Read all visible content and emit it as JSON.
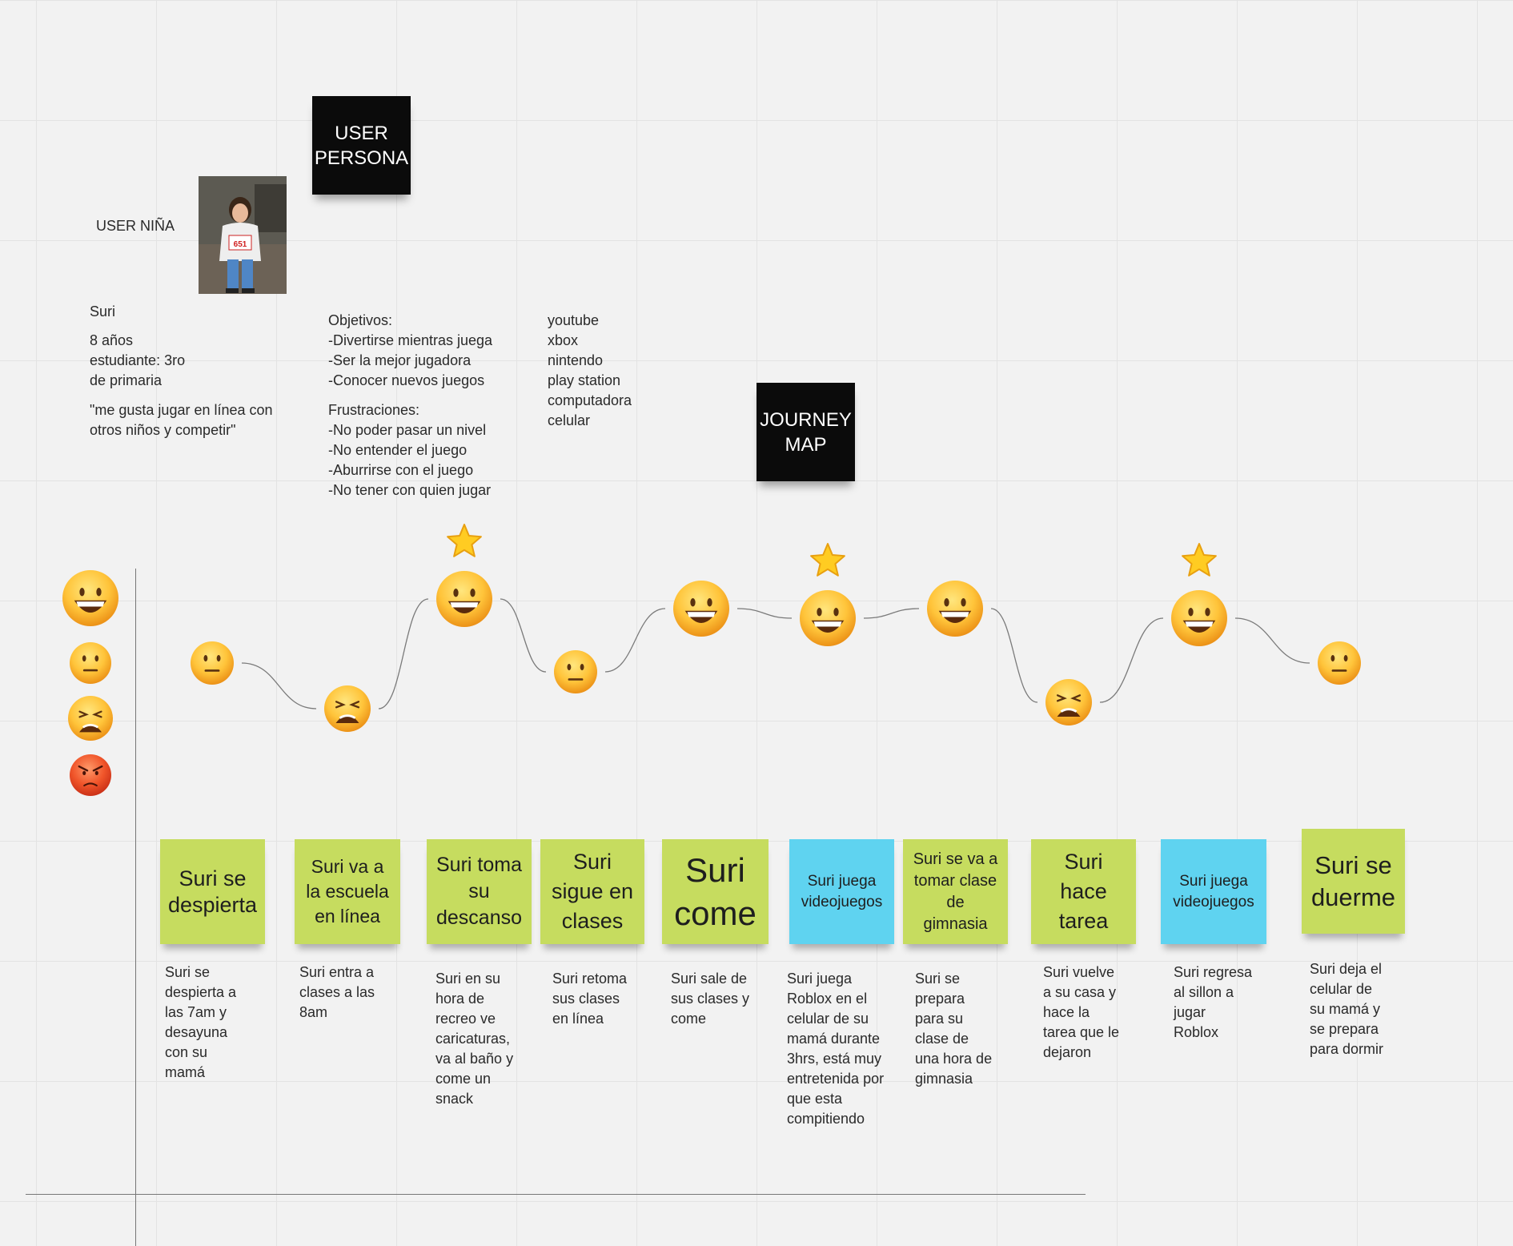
{
  "persona": {
    "title": "USER\nPERSONA",
    "user_label": "USER NIÑA",
    "name": "Suri",
    "details": "8 años\nestudiante: 3ro\nde primaria",
    "quote": "\"me gusta jugar en línea con\notros niños y competir\"",
    "goals": "Objetivos:\n-Divertirse mientras juega\n-Ser la mejor jugadora\n-Conocer nuevos juegos",
    "frustrations": "Frustraciones:\n-No poder pasar un nivel\n-No entender el juego\n-Aburrirse con el juego\n-No tener con quien jugar",
    "platforms": "youtube\nxbox\nnintendo\nplay station\ncomputadora\ncelular",
    "photo_bib": "651"
  },
  "journey": {
    "title": "JOURNEY\nMAP",
    "scale": [
      {
        "emotion": "happy"
      },
      {
        "emotion": "neutral"
      },
      {
        "emotion": "weary"
      },
      {
        "emotion": "angry"
      }
    ],
    "steps": [
      {
        "note": "Suri se\ndespierta",
        "color": "green",
        "emotion": "neutral",
        "star": false,
        "desc": "Suri se\ndespierta a\nlas 7am y\ndesayuna\ncon su\nmamá"
      },
      {
        "note": "Suri va a\nla escuela\nen línea",
        "color": "green",
        "emotion": "weary",
        "star": false,
        "desc": "Suri entra a\nclases a las\n8am"
      },
      {
        "note": "Suri toma\nsu\ndescanso",
        "color": "green",
        "emotion": "happy",
        "star": true,
        "desc": "Suri en su\nhora de\nrecreo ve\ncaricaturas,\nva al baño y\ncome un\nsnack"
      },
      {
        "note": "Suri\nsigue en\nclases",
        "color": "green",
        "emotion": "neutral",
        "star": false,
        "desc": "Suri retoma\nsus clases\nen línea"
      },
      {
        "note": "Suri\ncome",
        "color": "green",
        "emotion": "happy",
        "star": false,
        "desc": "Suri sale de\nsus clases y\ncome"
      },
      {
        "note": "Suri juega\nvideojuegos",
        "color": "blue",
        "emotion": "happy",
        "star": true,
        "desc": "Suri juega\nRoblox en el\ncelular de su\nmamá  durante\n3hrs, está muy\nentretenida por\nque esta\ncompitiendo"
      },
      {
        "note": "Suri se va a\ntomar clase\nde\ngimnasia",
        "color": "green",
        "emotion": "happy",
        "star": false,
        "desc": "Suri se\nprepara\npara su\nclase de\nuna hora de\ngimnasia"
      },
      {
        "note": "Suri\nhace\ntarea",
        "color": "green",
        "emotion": "weary",
        "star": false,
        "desc": "Suri vuelve\na su casa y\nhace la\ntarea que le\ndejaron"
      },
      {
        "note": "Suri juega\nvideojuegos",
        "color": "blue",
        "emotion": "happy",
        "star": true,
        "desc": "Suri regresa\nal sillon a\njugar\nRoblox"
      },
      {
        "note": "Suri se\nduerme",
        "color": "green",
        "emotion": "neutral",
        "star": false,
        "desc": "Suri deja el\ncelular de\nsu mamá y\nse prepara\npara dormir"
      }
    ]
  }
}
